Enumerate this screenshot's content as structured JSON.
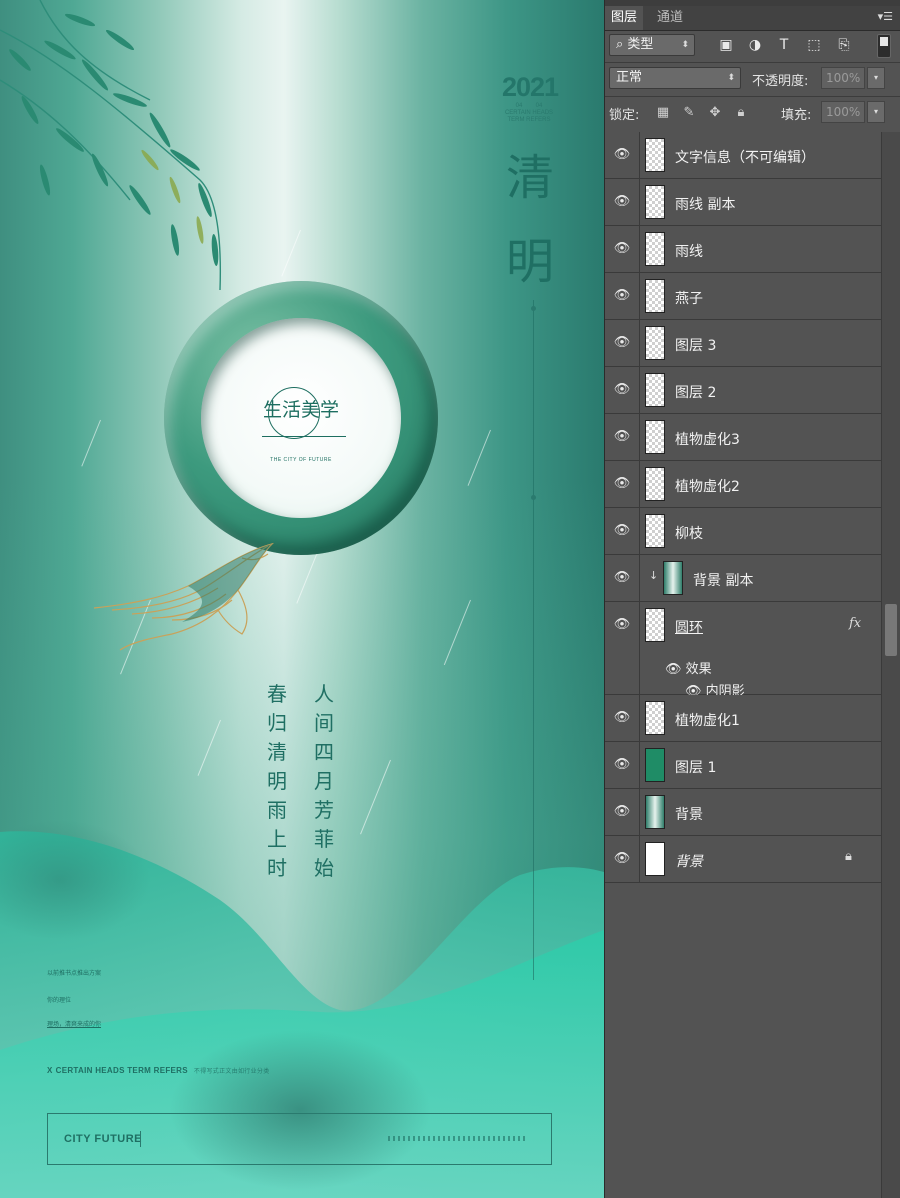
{
  "poster": {
    "year": "2021",
    "year_sub": [
      "04",
      "04",
      "CERTAIN HEADS",
      "TERM REFERS"
    ],
    "title_chars": [
      "清",
      "明"
    ],
    "logo": {
      "text": "生活美学",
      "subtitle": "THE CITY OF FUTURE"
    },
    "poem": {
      "left_column": "春归清明雨上时",
      "right_column": "人间四月芳菲始"
    },
    "info_lines": [
      "以前推书点推出方案",
      "你的理位",
      "理场，清爽来成的你"
    ],
    "tagline": {
      "prefix": "X",
      "bold": "CERTAIN HEADS TERM REFERS",
      "rest": "不得写式正文由如行业分类"
    },
    "footer": {
      "brand": "CITY FUTURE"
    }
  },
  "panel": {
    "tabs": [
      {
        "label": "图层",
        "active": true
      },
      {
        "label": "通道",
        "active": false
      }
    ],
    "filter": {
      "label": "类型"
    },
    "filter_icons": [
      "image-filter-icon",
      "adjustment-filter-icon",
      "type-filter-icon",
      "shape-filter-icon",
      "smart-object-filter-icon"
    ],
    "blend_mode": "正常",
    "opacity": {
      "label": "不透明度:",
      "value": "100%"
    },
    "lock": {
      "label": "锁定:"
    },
    "fill": {
      "label": "填充:",
      "value": "100%"
    },
    "layers": [
      {
        "name": "文字信息（不可编辑）",
        "thumb": "checker"
      },
      {
        "name": "雨线 副本",
        "thumb": "checker"
      },
      {
        "name": "雨线",
        "thumb": "checker"
      },
      {
        "name": "燕子",
        "thumb": "checker"
      },
      {
        "name": "图层 3",
        "thumb": "checker"
      },
      {
        "name": "图层 2",
        "thumb": "checker"
      },
      {
        "name": "植物虚化3",
        "thumb": "checker"
      },
      {
        "name": "植物虚化2",
        "thumb": "checker"
      },
      {
        "name": "柳枝",
        "thumb": "checker"
      },
      {
        "name": "背景 副本",
        "thumb": "grad",
        "clipped": true
      },
      {
        "name": "圆环",
        "thumb": "checker",
        "fx": "fx",
        "effects_label": "效果",
        "effect": "内阴影"
      },
      {
        "name": "植物虚化1",
        "thumb": "checker"
      },
      {
        "name": "图层 1",
        "thumb": "green"
      },
      {
        "name": "背景",
        "thumb": "grad"
      },
      {
        "name": "背景",
        "thumb": "white",
        "locked": true
      }
    ]
  }
}
